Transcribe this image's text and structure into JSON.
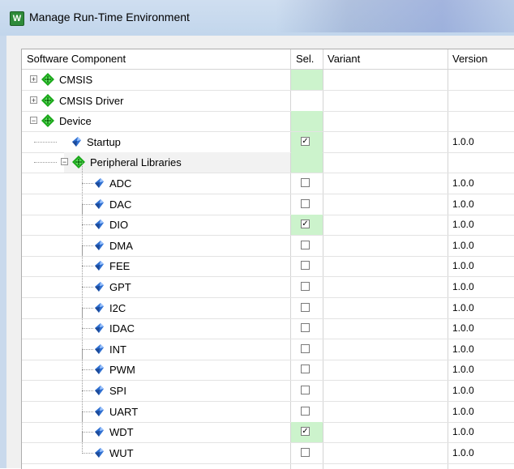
{
  "window": {
    "title": "Manage Run-Time Environment",
    "icon_name": "app-icon"
  },
  "columns": {
    "component": "Software Component",
    "sel": "Sel.",
    "variant": "Variant",
    "version": "Version"
  },
  "rows": [
    {
      "label": "CMSIS",
      "level": 0,
      "expander": "plus",
      "icon": "component-diamond-icon",
      "checkbox": null,
      "sel_green": true,
      "version": ""
    },
    {
      "label": "CMSIS Driver",
      "level": 0,
      "expander": "plus",
      "icon": "component-diamond-icon",
      "checkbox": null,
      "sel_green": false,
      "version": ""
    },
    {
      "label": "Device",
      "level": 0,
      "expander": "minus",
      "icon": "component-diamond-icon",
      "checkbox": null,
      "sel_green": true,
      "version": ""
    },
    {
      "label": "Startup",
      "level": 1,
      "expander": null,
      "icon": "blue-gem-icon",
      "checkbox": true,
      "sel_green": true,
      "version": "1.0.0"
    },
    {
      "label": "Peripheral Libraries",
      "level": 1,
      "expander": "minus",
      "icon": "component-diamond-icon",
      "checkbox": null,
      "sel_green": true,
      "version": "",
      "highlight": true
    },
    {
      "label": "ADC",
      "level": 2,
      "expander": null,
      "icon": "blue-gem-icon",
      "checkbox": false,
      "sel_green": false,
      "version": "1.0.0"
    },
    {
      "label": "DAC",
      "level": 2,
      "expander": null,
      "icon": "blue-gem-icon",
      "checkbox": false,
      "sel_green": false,
      "version": "1.0.0"
    },
    {
      "label": "DIO",
      "level": 2,
      "expander": null,
      "icon": "blue-gem-icon",
      "checkbox": true,
      "sel_green": true,
      "version": "1.0.0"
    },
    {
      "label": "DMA",
      "level": 2,
      "expander": null,
      "icon": "blue-gem-icon",
      "checkbox": false,
      "sel_green": false,
      "version": "1.0.0"
    },
    {
      "label": "FEE",
      "level": 2,
      "expander": null,
      "icon": "blue-gem-icon",
      "checkbox": false,
      "sel_green": false,
      "version": "1.0.0"
    },
    {
      "label": "GPT",
      "level": 2,
      "expander": null,
      "icon": "blue-gem-icon",
      "checkbox": false,
      "sel_green": false,
      "version": "1.0.0"
    },
    {
      "label": "I2C",
      "level": 2,
      "expander": null,
      "icon": "blue-gem-icon",
      "checkbox": false,
      "sel_green": false,
      "version": "1.0.0"
    },
    {
      "label": "IDAC",
      "level": 2,
      "expander": null,
      "icon": "blue-gem-icon",
      "checkbox": false,
      "sel_green": false,
      "version": "1.0.0"
    },
    {
      "label": "INT",
      "level": 2,
      "expander": null,
      "icon": "blue-gem-icon",
      "checkbox": false,
      "sel_green": false,
      "version": "1.0.0"
    },
    {
      "label": "PWM",
      "level": 2,
      "expander": null,
      "icon": "blue-gem-icon",
      "checkbox": false,
      "sel_green": false,
      "version": "1.0.0"
    },
    {
      "label": "SPI",
      "level": 2,
      "expander": null,
      "icon": "blue-gem-icon",
      "checkbox": false,
      "sel_green": false,
      "version": "1.0.0"
    },
    {
      "label": "UART",
      "level": 2,
      "expander": null,
      "icon": "blue-gem-icon",
      "checkbox": false,
      "sel_green": false,
      "version": "1.0.0"
    },
    {
      "label": "WDT",
      "level": 2,
      "expander": null,
      "icon": "blue-gem-icon",
      "checkbox": true,
      "sel_green": true,
      "version": "1.0.0"
    },
    {
      "label": "WUT",
      "level": 2,
      "expander": null,
      "icon": "blue-gem-icon",
      "checkbox": false,
      "sel_green": false,
      "version": "1.0.0"
    }
  ],
  "colors": {
    "selected_cell": "#ccf3cc",
    "diamond": "#1aa81a",
    "gem": "#2f6fd0"
  }
}
